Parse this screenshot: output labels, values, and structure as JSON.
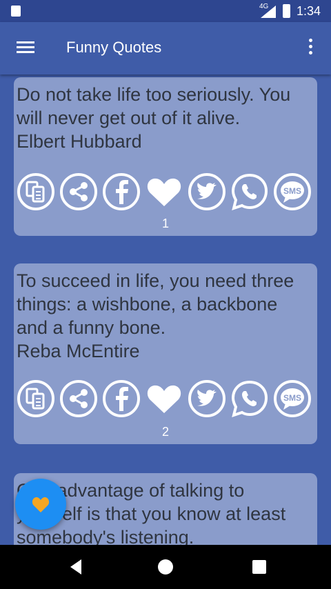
{
  "status": {
    "network": "4G",
    "time": "1:34"
  },
  "appbar": {
    "title": "Funny Quotes",
    "menu_icon": "hamburger-menu-icon",
    "overflow_icon": "more-vert-icon"
  },
  "quotes": [
    {
      "text": "Do not take life too seriously. You will never get out of it alive.",
      "author": "Elbert Hubbard",
      "number": "1"
    },
    {
      "text": "To succeed in life, you need three things: a wishbone, a backbone and a funny bone.",
      "author": "Reba McEntire",
      "number": "2"
    },
    {
      "text": "One advantage of talking to yourself is that you know at least somebody's listening.",
      "author": "",
      "number": ""
    }
  ],
  "actions": [
    "copy-icon",
    "share-icon",
    "facebook-icon",
    "heart-icon",
    "twitter-icon",
    "whatsapp-icon",
    "sms-icon"
  ],
  "sms_label": "SMS",
  "fab": {
    "icon": "heart-icon",
    "color": "#1d8ef3"
  },
  "colors": {
    "background": "#3f5ca8",
    "card": "#8a9ccb",
    "statusbar": "#2e4690",
    "heart_fab": "#f5a623"
  }
}
